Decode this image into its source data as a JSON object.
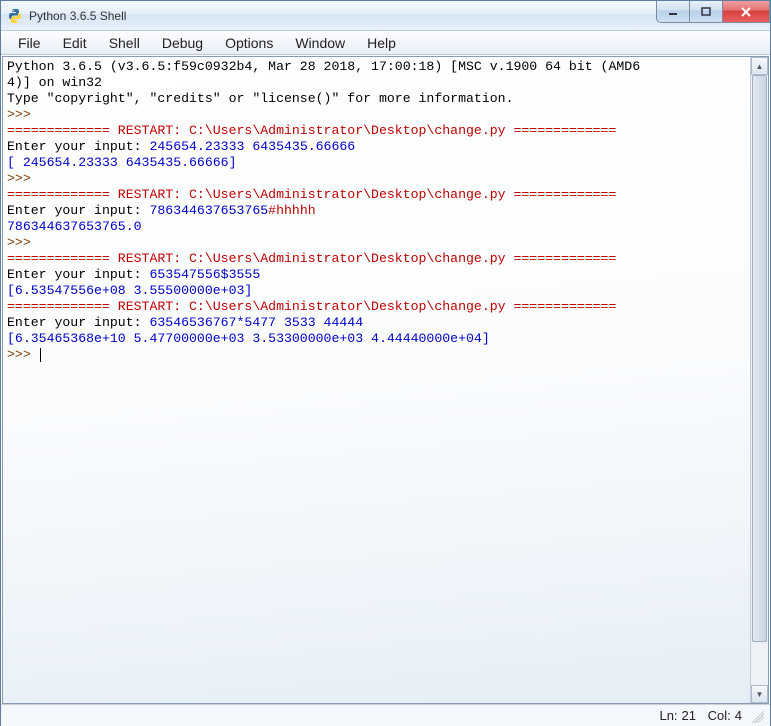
{
  "window": {
    "title": "Python 3.6.5 Shell"
  },
  "menu": {
    "items": [
      "File",
      "Edit",
      "Shell",
      "Debug",
      "Options",
      "Window",
      "Help"
    ]
  },
  "shell": {
    "header1": "Python 3.6.5 (v3.6.5:f59c0932b4, Mar 28 2018, 17:00:18) [MSC v.1900 64 bit (AMD6",
    "header2": "4)] on win32",
    "help": "Type \"copyright\", \"credits\" or \"license()\" for more information.",
    "prompt": ">>> ",
    "restart1": "============= RESTART: C:\\Users\\Administrator\\Desktop\\change.py =============",
    "input_label": "Enter your input: ",
    "run1_input": "245654.23333 6435435.66666",
    "run1_out": "[ 245654.23333 6435435.66666]",
    "restart2": "============= RESTART: C:\\Users\\Administrator\\Desktop\\change.py =============",
    "run2_input_a": "786344637653765",
    "run2_input_b": "#hhhhh",
    "run2_out": "786344637653765.0",
    "restart3": "============= RESTART: C:\\Users\\Administrator\\Desktop\\change.py =============",
    "run3_input": "653547556$3555",
    "run3_out": "[6.53547556e+08 3.55500000e+03]",
    "restart4": "============= RESTART: C:\\Users\\Administrator\\Desktop\\change.py =============",
    "run4_input": "63546536767*5477 3533 44444",
    "run4_out": "[6.35465368e+10 5.47700000e+03 3.53300000e+03 4.44440000e+04]"
  },
  "status": {
    "ln_label": "Ln:",
    "ln_value": "21",
    "col_label": "Col:",
    "col_value": "4"
  }
}
